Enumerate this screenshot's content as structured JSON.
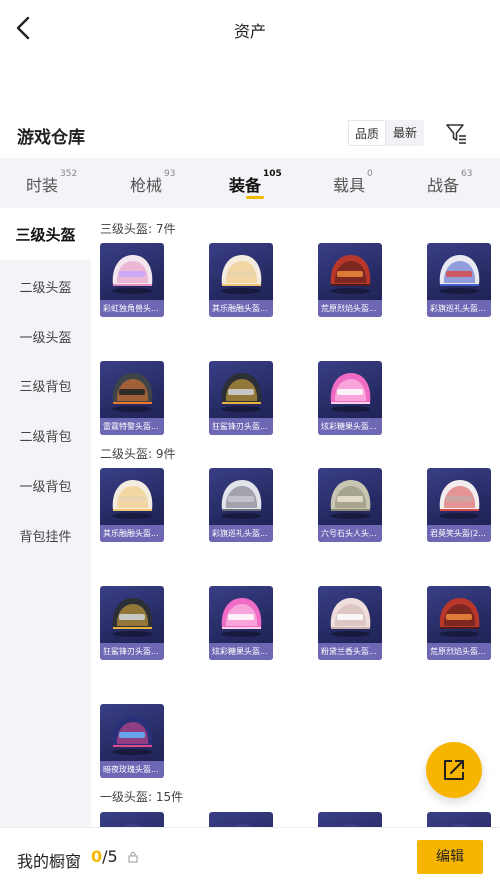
{
  "header": {
    "title": "资产"
  },
  "warehouse": {
    "title": "游戏仓库",
    "sort": [
      "品质",
      "最新"
    ]
  },
  "tabs": [
    {
      "label": "时装",
      "count": "352"
    },
    {
      "label": "枪械",
      "count": "93"
    },
    {
      "label": "装备",
      "count": "105"
    },
    {
      "label": "载具",
      "count": "0"
    },
    {
      "label": "战备",
      "count": "63"
    }
  ],
  "sidebar": [
    "三级头盔",
    "二级头盔",
    "一级头盔",
    "三级背包",
    "二级背包",
    "一级背包",
    "背包挂件"
  ],
  "sections": [
    {
      "title": "三级头盔: 7件"
    },
    {
      "title": "二级头盔: 9件"
    },
    {
      "title": "一级头盔: 15件"
    }
  ],
  "items": [
    {
      "name": "彩虹独角兽头...",
      "icon": "rainbow-unicorn-helmet-icon",
      "colors": {
        "main": "#f2e6ef",
        "accent": "#e58fc0",
        "trim": "#c7a6ff"
      }
    },
    {
      "name": "其乐融融头盔...",
      "icon": "cream-helmet-icon",
      "colors": {
        "main": "#f4ece0",
        "accent": "#f0c770",
        "trim": "#e8d4b0"
      }
    },
    {
      "name": "荒原烈焰头盔...",
      "icon": "wasteland-flame-helmet-icon",
      "colors": {
        "main": "#b9362b",
        "accent": "#4a1d1a",
        "trim": "#f08a3c"
      }
    },
    {
      "name": "彩旗巡礼头盔...",
      "icon": "flag-parade-helmet-icon",
      "colors": {
        "main": "#e9e9f1",
        "accent": "#4a5fc9",
        "trim": "#d64c4c"
      }
    },
    {
      "name": "雷霆特警头盔...",
      "icon": "thunder-swat-helmet-icon",
      "colors": {
        "main": "#3f4448",
        "accent": "#f07a2c",
        "trim": "#1f2326"
      }
    },
    {
      "name": "狂鲨锋刃头盔...",
      "icon": "shark-blade-helmet-icon",
      "colors": {
        "main": "#2c2f36",
        "accent": "#e8b33a",
        "trim": "#cfd3da"
      }
    },
    {
      "name": "炫彩糖果头盔...",
      "icon": "candy-helmet-icon",
      "colors": {
        "main": "#f06cc4",
        "accent": "#ffd1ec",
        "trim": "#ffffff"
      }
    },
    {
      "name": "君莫笑头盔(2...",
      "icon": "jun-mo-xiao-helmet-icon",
      "colors": {
        "main": "#f2eeee",
        "accent": "#d94b4b",
        "trim": "#caa6a6"
      }
    },
    {
      "name": "其乐融融头盔...",
      "icon": "cream-helmet-icon",
      "colors": {
        "main": "#f4ece0",
        "accent": "#f0c770",
        "trim": "#e8d4b0"
      }
    },
    {
      "name": "彩旗巡礼头盔...",
      "icon": "flag-parade-helmet-icon",
      "colors": {
        "main": "#e3e3ea",
        "accent": "#6d6f7a",
        "trim": "#c9c9d4"
      }
    },
    {
      "name": "六号石头人头...",
      "icon": "stone-man-helmet-icon",
      "colors": {
        "main": "#c8c5b2",
        "accent": "#8d8a74",
        "trim": "#e7e3cf"
      }
    },
    {
      "name": "荒原烈焰头盔...",
      "icon": "wasteland-flame-helmet-icon",
      "colors": {
        "main": "#b9362b",
        "accent": "#4a1d1a",
        "trim": "#f08a3c"
      }
    },
    {
      "name": "狂鲨锋刃头盔...",
      "icon": "shark-blade-helmet-icon",
      "colors": {
        "main": "#2c2f36",
        "accent": "#e8b33a",
        "trim": "#cfd3da"
      }
    },
    {
      "name": "炫彩糖果头盔...",
      "icon": "candy-helmet-icon",
      "colors": {
        "main": "#f06cc4",
        "accent": "#ffd1ec",
        "trim": "#ffffff"
      }
    },
    {
      "name": "粉黛兰香头盔...",
      "icon": "pink-orchid-helmet-icon",
      "colors": {
        "main": "#efdedc",
        "accent": "#cfb3b0",
        "trim": "#ffffff"
      }
    },
    {
      "name": "暗夜玫瑰头盔...",
      "icon": "night-rose-helmet-icon",
      "colors": {
        "main": "#2a2f7a",
        "accent": "#e24a8a",
        "trim": "#5fb6ff"
      }
    },
    {
      "name": "",
      "icon": "helmet-icon",
      "colors": {
        "main": "#3a3f86",
        "accent": "#3a3f86",
        "trim": "#3a3f86"
      }
    },
    {
      "name": "",
      "icon": "helmet-icon",
      "colors": {
        "main": "#3a3f86",
        "accent": "#3a3f86",
        "trim": "#3a3f86"
      }
    },
    {
      "name": "",
      "icon": "helmet-icon",
      "colors": {
        "main": "#3a3f86",
        "accent": "#93c43a",
        "trim": "#3a3f86"
      }
    },
    {
      "name": "",
      "icon": "helmet-icon",
      "colors": {
        "main": "#3a3f86",
        "accent": "#3a3f86",
        "trim": "#3a3f86"
      }
    }
  ],
  "showcase": {
    "label": "我的橱窗",
    "current": "0",
    "total": "/5",
    "edit_label": "编辑"
  },
  "theme": {
    "accent": "#f7b500",
    "panel": "#f3f4f7",
    "card_label": "#6e67b4"
  }
}
